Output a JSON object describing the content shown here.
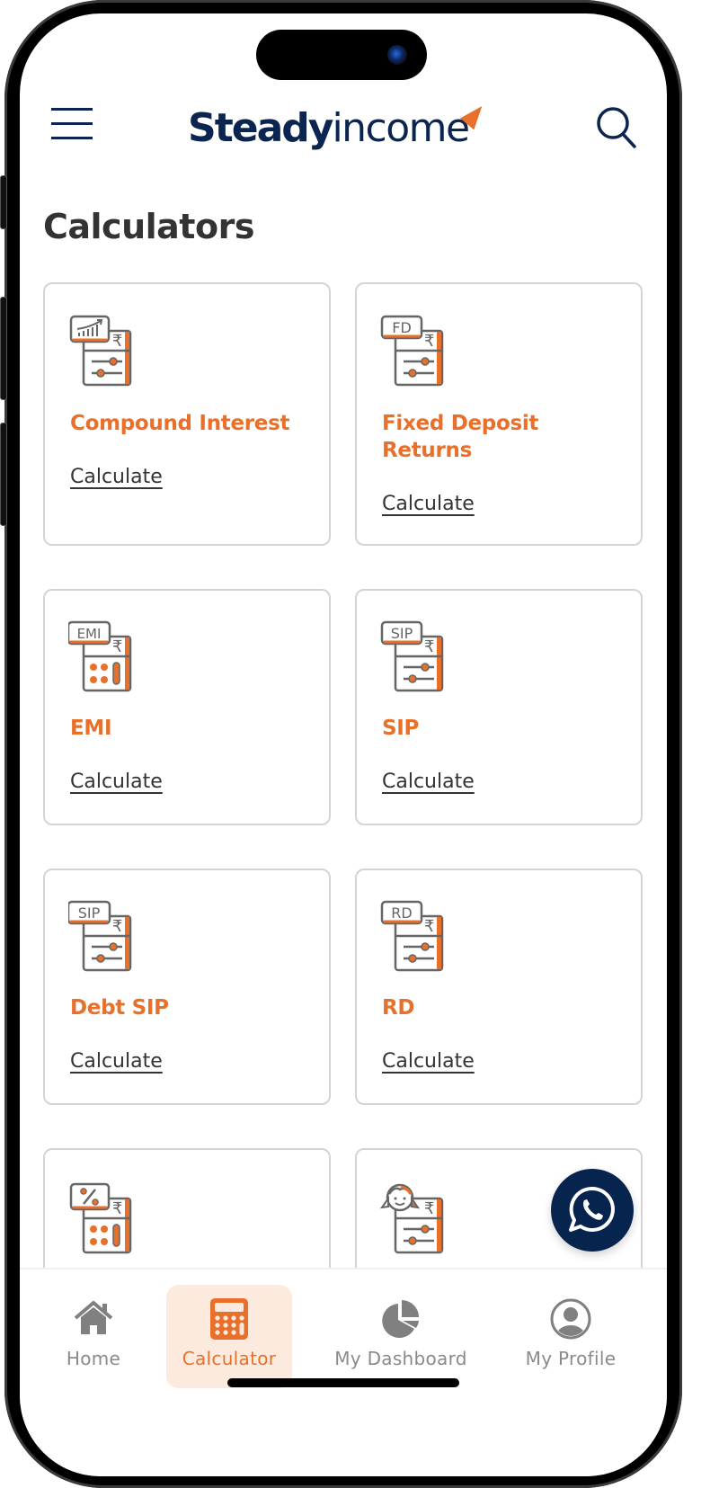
{
  "header": {
    "menu_icon": "hamburger-menu-icon",
    "logo_bold": "Steady",
    "logo_light": "income",
    "search_icon": "search-icon"
  },
  "page": {
    "title": "Calculators"
  },
  "cards": [
    {
      "title": "Compound Interest",
      "link": "Calculate",
      "icon": "compound-interest-calculator-icon",
      "icon_badge": ""
    },
    {
      "title": "Fixed Deposit Returns",
      "link": "Calculate",
      "icon": "fd-calculator-icon",
      "icon_badge": "FD"
    },
    {
      "title": "EMI",
      "link": "Calculate",
      "icon": "emi-calculator-icon",
      "icon_badge": "EMI"
    },
    {
      "title": "SIP",
      "link": "Calculate",
      "icon": "sip-calculator-icon",
      "icon_badge": "SIP"
    },
    {
      "title": "Debt SIP",
      "link": "Calculate",
      "icon": "debt-sip-calculator-icon",
      "icon_badge": "SIP"
    },
    {
      "title": "RD",
      "link": "Calculate",
      "icon": "rd-calculator-icon",
      "icon_badge": "RD"
    },
    {
      "title": "",
      "link": "",
      "icon": "percent-calculator-icon",
      "icon_badge": "%"
    },
    {
      "title": "",
      "link": "",
      "icon": "girl-child-calculator-icon",
      "icon_badge": ""
    }
  ],
  "bottom_nav": {
    "items": [
      {
        "label": "Home",
        "icon": "home-icon",
        "active": false
      },
      {
        "label": "Calculator",
        "icon": "calculator-icon",
        "active": true
      },
      {
        "label": "My Dashboard",
        "icon": "pie-chart-icon",
        "active": false
      },
      {
        "label": "My Profile",
        "icon": "user-profile-icon",
        "active": false
      }
    ]
  },
  "fab": {
    "icon": "whatsapp-icon"
  },
  "colors": {
    "brand_navy": "#0c2550",
    "accent_orange": "#e8702a",
    "active_tab_bg": "#fdeade",
    "fab_bg": "#07244f",
    "card_border": "#d4d4d4",
    "muted_text": "#8a8a8a"
  }
}
